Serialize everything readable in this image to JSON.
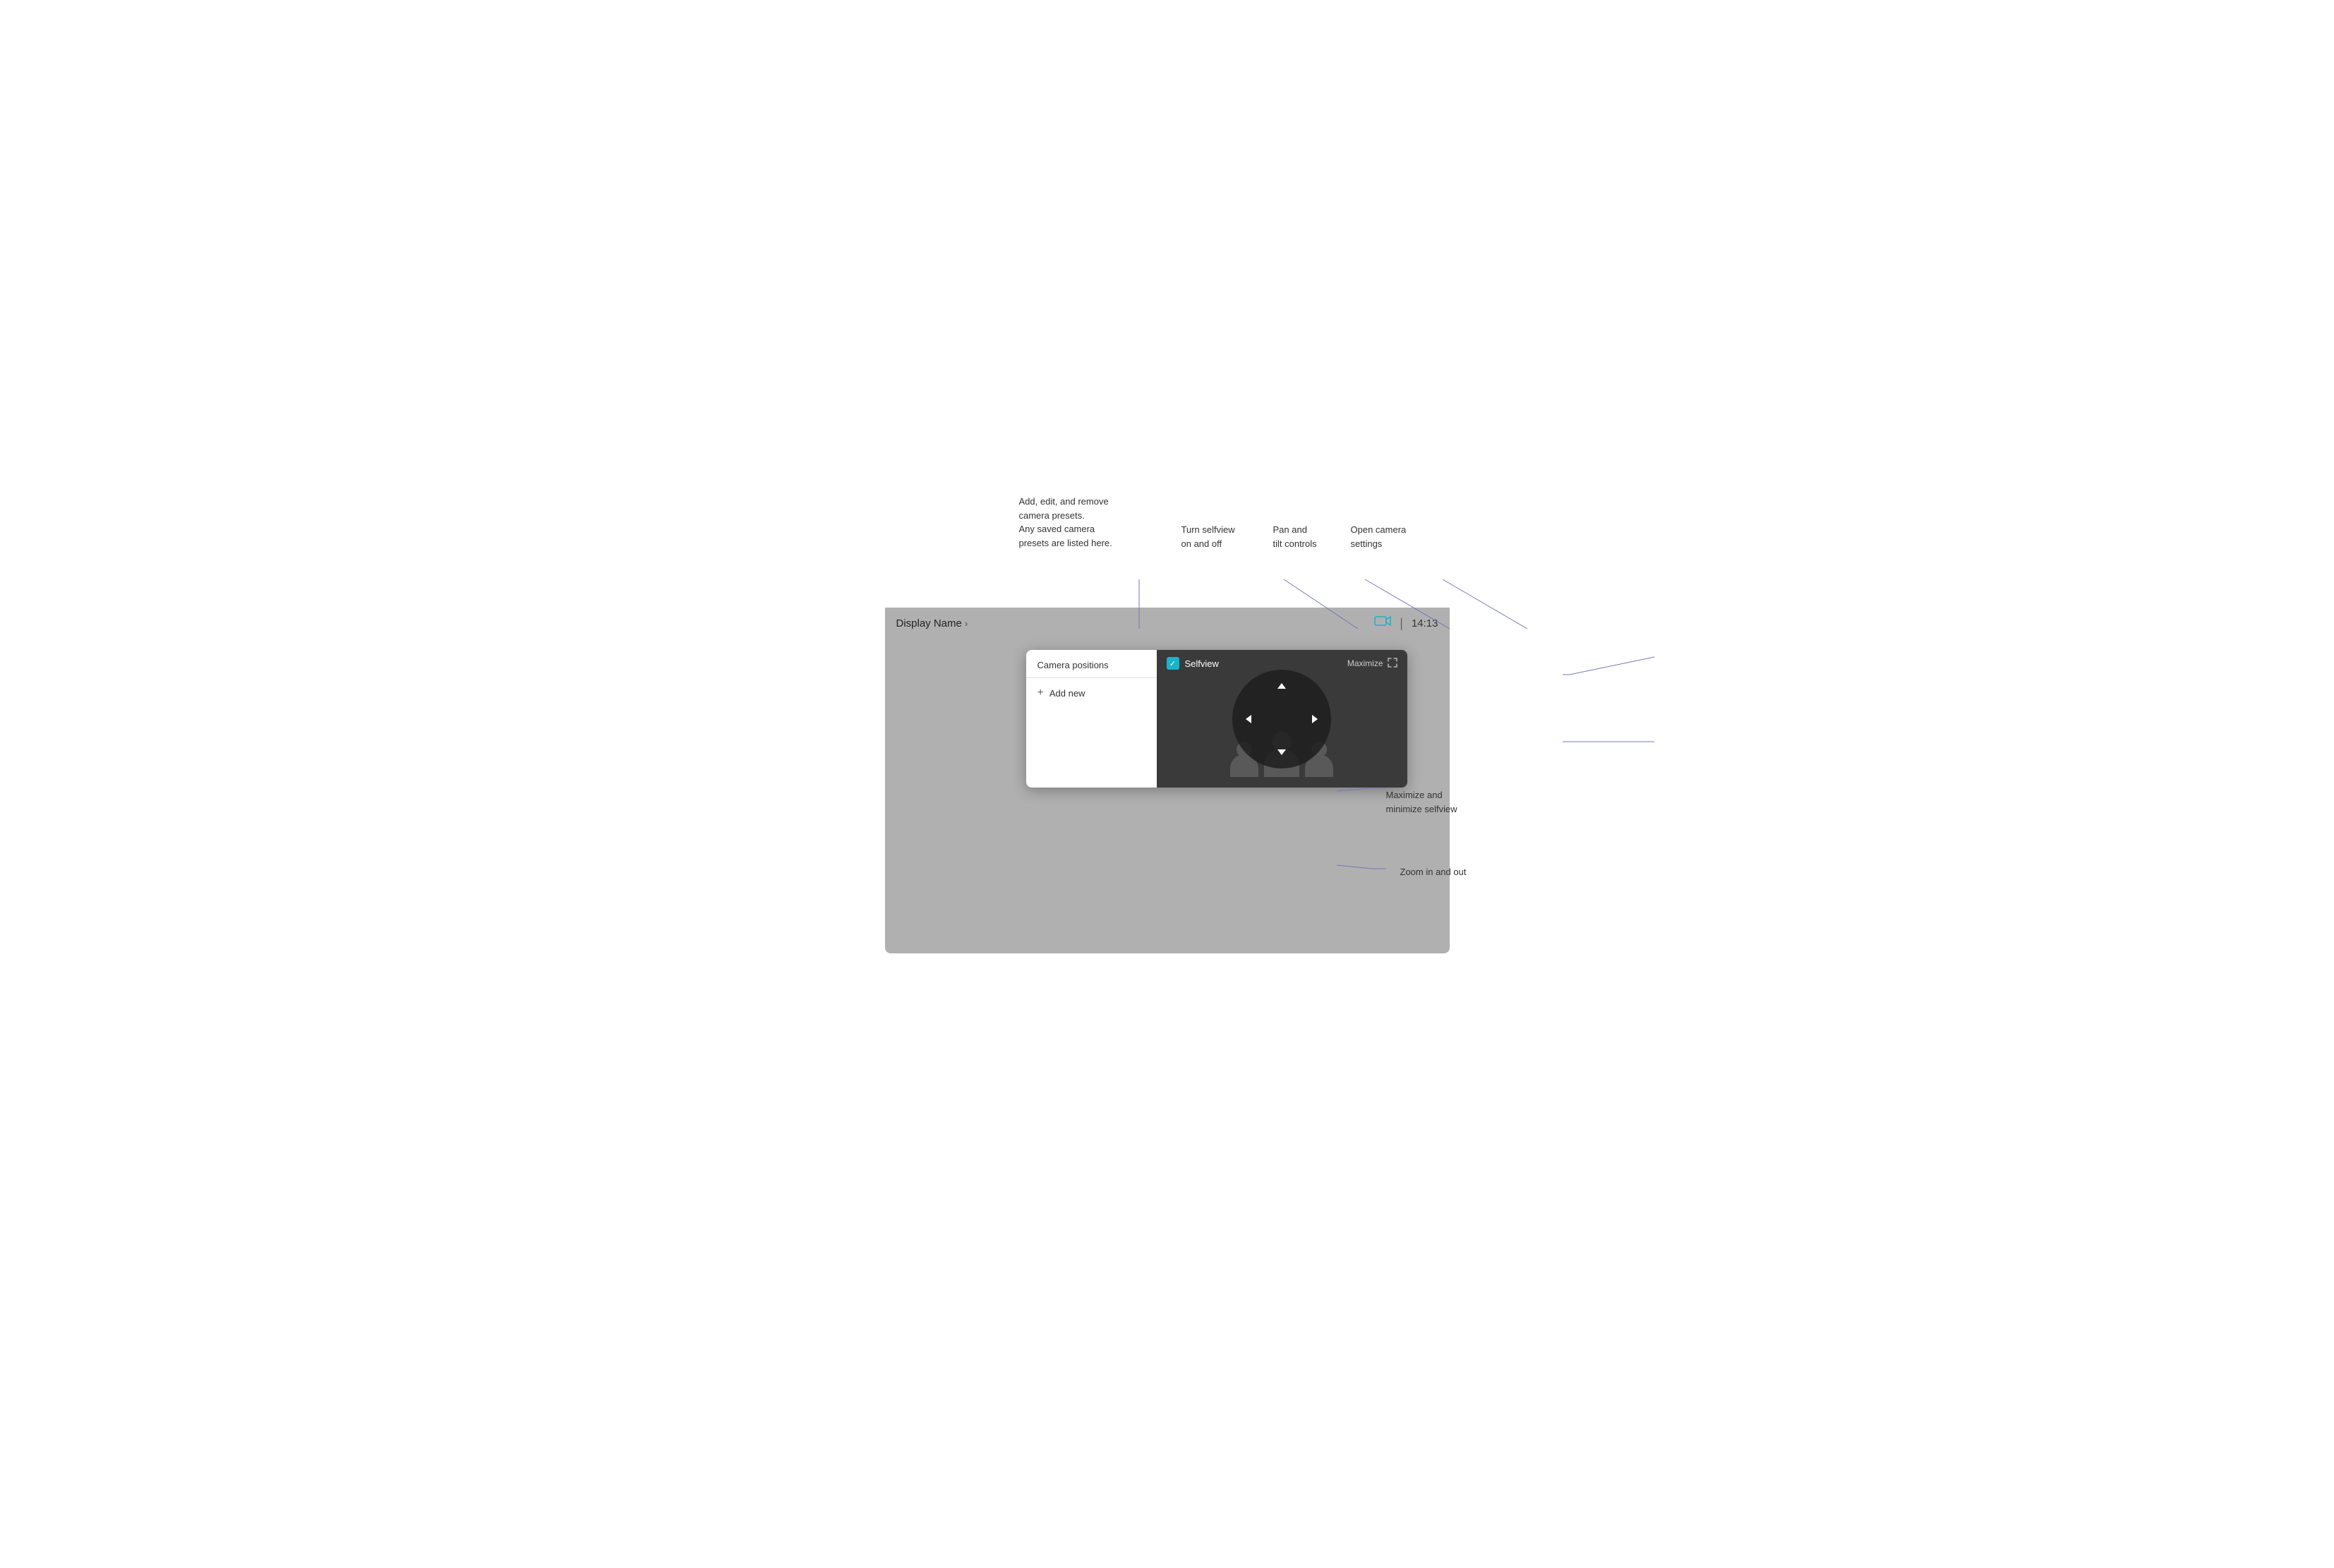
{
  "annotations": {
    "camera_presets": {
      "label": "Add, edit, and remove\ncamera presets.\nAny saved camera\npresets are listed here."
    },
    "selfview_toggle": {
      "label": "Turn selfview\non and off"
    },
    "pan_tilt": {
      "label": "Pan and\ntilt controls"
    },
    "camera_settings": {
      "label": "Open camera\nsettings"
    },
    "maximize_selfview": {
      "label": "Maximize and\nminimize selfview"
    },
    "zoom": {
      "label": "Zoom in and out"
    }
  },
  "device": {
    "display_name": "Display Name",
    "time": "14:13"
  },
  "camera_positions": {
    "title": "Camera positions",
    "add_new": "Add new"
  },
  "selfview": {
    "label": "Selfview",
    "checked": true,
    "maximize_label": "Maximize"
  },
  "ptz": {
    "up": "‹",
    "down": "›",
    "left": "‹",
    "right": "›"
  },
  "zoom_controls": {
    "zoom_in": "+",
    "zoom_out": "−"
  }
}
